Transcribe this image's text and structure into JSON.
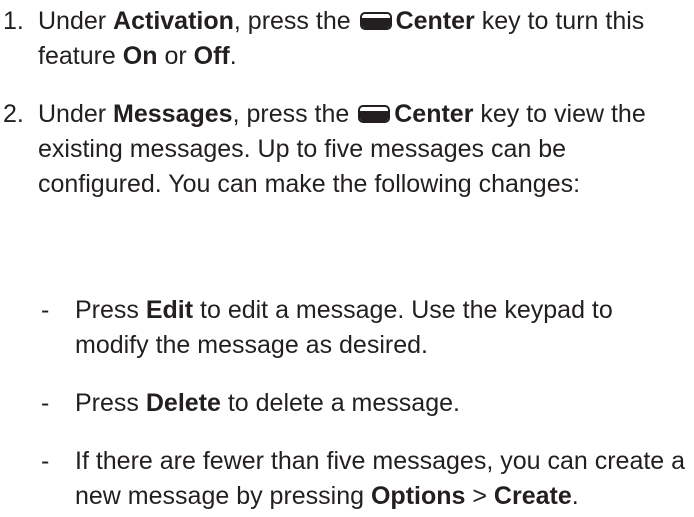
{
  "steps": [
    {
      "number": "1.",
      "parts": [
        "Under ",
        "Activation",
        ", press the ",
        "Center",
        " key to turn this feature ",
        "On",
        " or ",
        "Off",
        "."
      ],
      "key_icon": "center-key-icon"
    },
    {
      "number": "2.",
      "parts": [
        "Under ",
        "Messages",
        ", press the ",
        "Center",
        " key to view the existing messages. Up to five messages can be configured. You can make the following changes:"
      ],
      "key_icon": "center-key-icon"
    }
  ],
  "sub_items": [
    {
      "bullet": "-",
      "parts": [
        "Press ",
        "Edit",
        " to edit a message. Use the keypad to modify the message as desired."
      ]
    },
    {
      "bullet": "-",
      "parts": [
        "Press ",
        "Delete",
        " to delete a message."
      ]
    },
    {
      "bullet": "-",
      "parts": [
        "If there are fewer than five messages, you can create a new message by pressing ",
        "Options",
        " > ",
        "Create",
        "."
      ]
    }
  ]
}
